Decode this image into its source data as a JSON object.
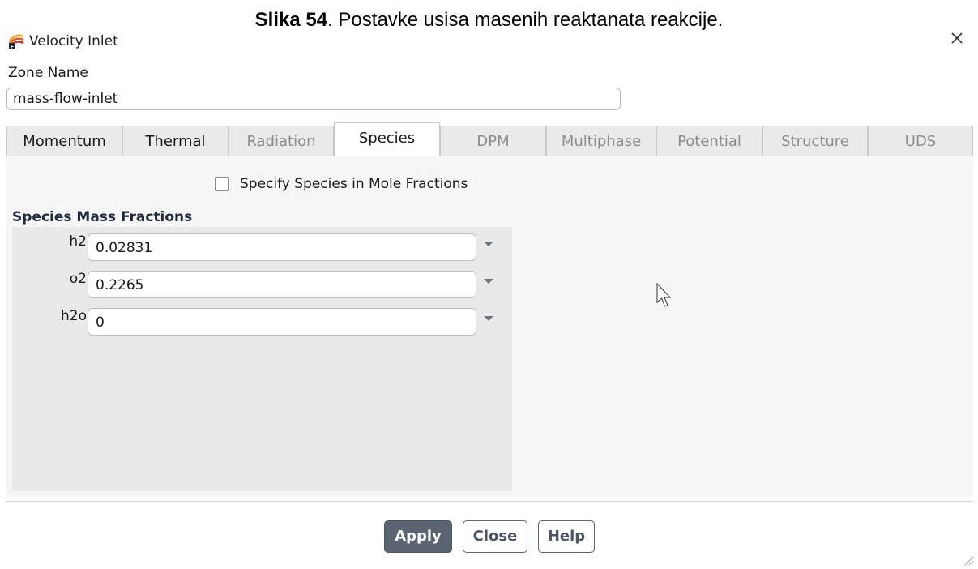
{
  "caption": {
    "label": "Slika 54",
    "text": ". Postavke usisa masenih reaktanata reakcije."
  },
  "window": {
    "title": "Velocity Inlet",
    "close_icon": "close-icon",
    "app_icon": "fluent-icon"
  },
  "zone": {
    "label": "Zone Name",
    "value": "mass-flow-inlet"
  },
  "tabs": [
    {
      "label": "Momentum",
      "state": "normal"
    },
    {
      "label": "Thermal",
      "state": "normal"
    },
    {
      "label": "Radiation",
      "state": "disabled"
    },
    {
      "label": "Species",
      "state": "active"
    },
    {
      "label": "DPM",
      "state": "disabled"
    },
    {
      "label": "Multiphase",
      "state": "disabled"
    },
    {
      "label": "Potential",
      "state": "disabled"
    },
    {
      "label": "Structure",
      "state": "disabled"
    },
    {
      "label": "UDS",
      "state": "disabled"
    }
  ],
  "species_panel": {
    "mole_fraction_checkbox": {
      "label": "Specify Species in Mole Fractions",
      "checked": false
    },
    "section_title": "Species Mass Fractions",
    "species": [
      {
        "name": "h2",
        "value": "0.02831"
      },
      {
        "name": "o2",
        "value": "0.2265"
      },
      {
        "name": "h2o",
        "value": "0"
      }
    ]
  },
  "buttons": {
    "apply": "Apply",
    "close": "Close",
    "help": "Help"
  },
  "colors": {
    "primary_button": "#5b6572",
    "panel_bg": "#f6f6f6",
    "species_bg": "#e9e9e9"
  }
}
